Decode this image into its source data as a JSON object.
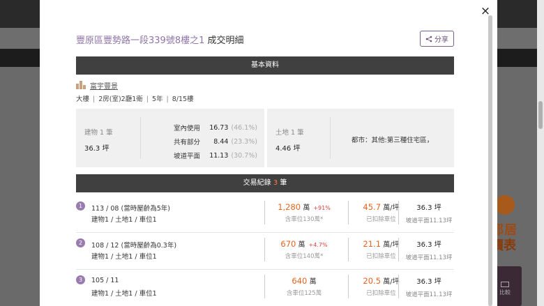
{
  "background": {
    "promo_line1": "都居",
    "promo_line2": "價表",
    "compare_label": "比較"
  },
  "modal": {
    "close_symbol": "×",
    "address": "豐原區豐勢路一段339號8樓之1",
    "title_suffix": "成交明細",
    "share_label": "分享"
  },
  "basic_info": {
    "section_title": "基本資料",
    "community_name": "富宇豐景",
    "specs": [
      "大樓",
      "2房(室)2廳1衛",
      "5年",
      "8/15樓"
    ],
    "building": {
      "label": "建物 1 筆",
      "area": "36.3 坪"
    },
    "areas": [
      {
        "key": "室內使用",
        "value": "16.73",
        "pct": "(46.1%)"
      },
      {
        "key": "共有部分",
        "value": "8.44",
        "pct": "(23.3%)"
      },
      {
        "key": "坡道平面",
        "value": "11.13",
        "pct": "(30.7%)"
      }
    ],
    "land": {
      "label": "土地 1 筆",
      "area": "4.46 坪"
    },
    "zoning": "都市：其他:第三種住宅區，"
  },
  "transactions": {
    "title_prefix": "交易紀錄",
    "count": "3",
    "title_suffix": "筆",
    "records": [
      {
        "num": "1",
        "date": "113 / 08",
        "age_note": "(當時屋齡為5年)",
        "composition": "建物1 / 土地1 / 車位1",
        "price": "1,280",
        "price_unit": "萬",
        "change": "+91%",
        "price_note": "含車位130萬*",
        "unit_price": "45.7",
        "unit_price_unit": "萬/坪",
        "unit_note": "已扣除車位",
        "area": "36.3 坪",
        "area_note": "坡道平面11.13坪"
      },
      {
        "num": "2",
        "date": "108 / 12",
        "age_note": "(當時屋齡為0.3年)",
        "composition": "建物1 / 土地1 / 車位1",
        "price": "670",
        "price_unit": "萬",
        "change": "+4.7%",
        "price_note": "含車位140萬*",
        "unit_price": "21.1",
        "unit_price_unit": "萬/坪",
        "unit_note": "已扣除車位",
        "area": "36.3 坪",
        "area_note": "坡道平面11.13坪"
      },
      {
        "num": "3",
        "date": "105 / 11",
        "age_note": "",
        "composition": "建物1 / 土地1 / 車位1",
        "price": "640",
        "price_unit": "萬",
        "change": "",
        "price_note": "含車位125萬",
        "unit_price": "20.5",
        "unit_price_unit": "萬/坪",
        "unit_note": "已扣除車位",
        "area": "36.3 坪",
        "area_note": "坡道平面11.13坪"
      }
    ]
  },
  "colors": {
    "accent_purple": "#8f74a8",
    "price_orange": "#e8631e",
    "change_red": "#e23b3b",
    "section_bar": "#404040"
  }
}
